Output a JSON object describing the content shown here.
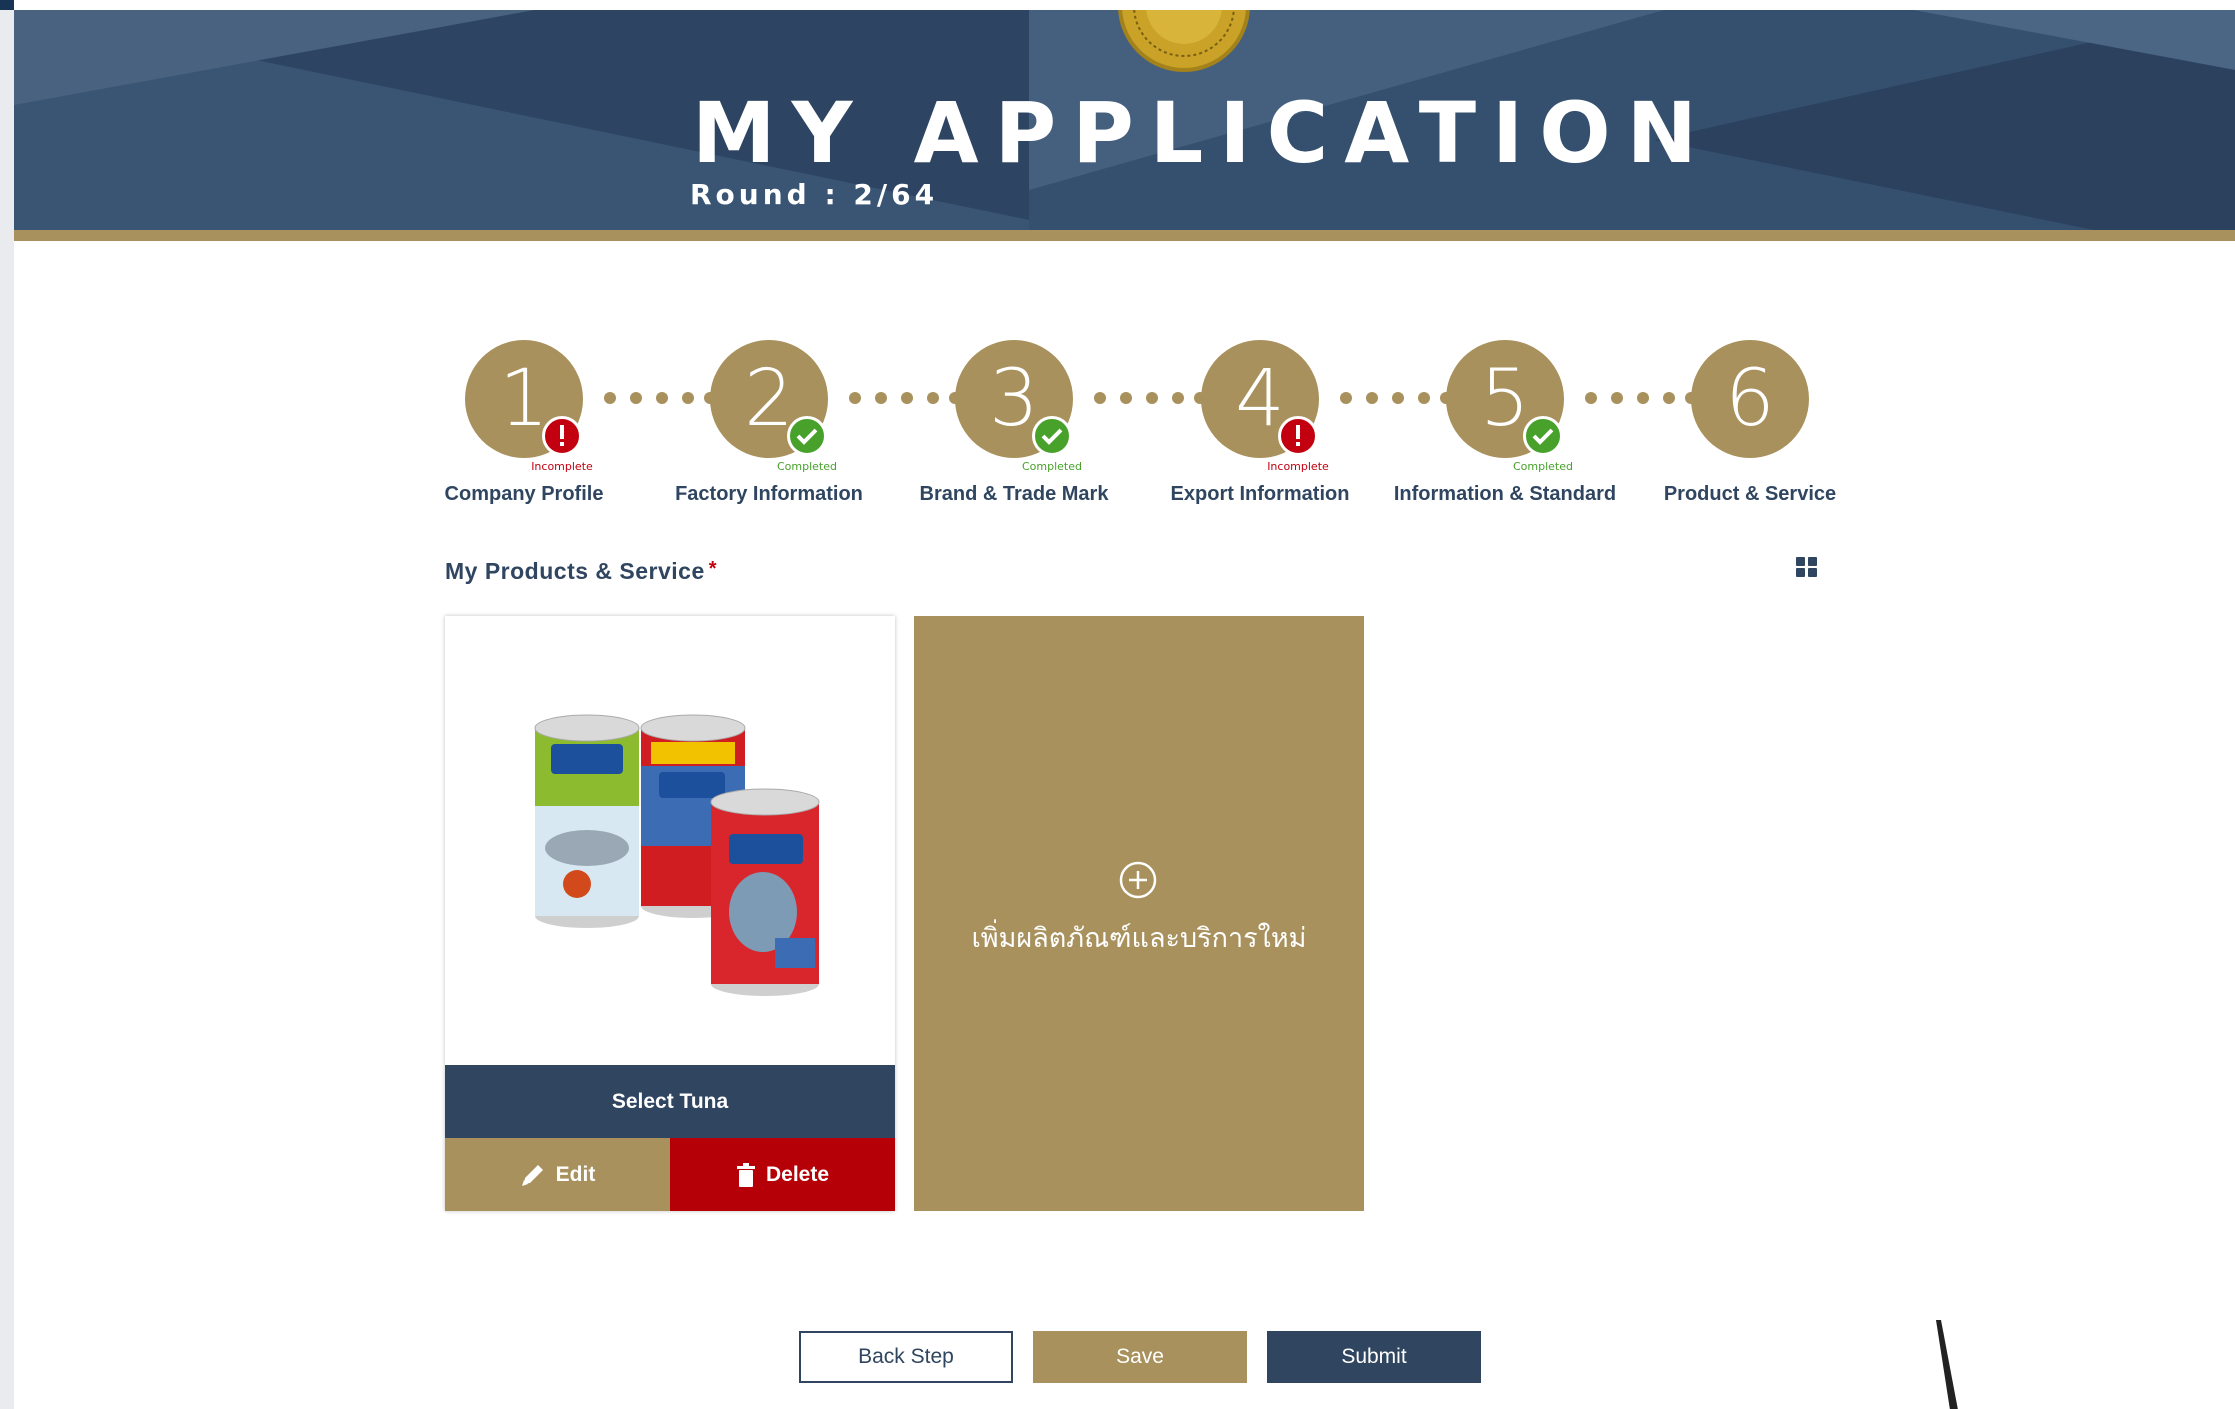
{
  "header": {
    "title": "MY APPLICATION",
    "round": "Round : 2/64"
  },
  "stepper": {
    "steps": [
      {
        "number": "1",
        "label": "Company Profile",
        "status": "Incomplete"
      },
      {
        "number": "2",
        "label": "Factory Information",
        "status": "Completed"
      },
      {
        "number": "3",
        "label": "Brand & Trade Mark",
        "status": "Completed"
      },
      {
        "number": "4",
        "label": "Export Information",
        "status": "Incomplete"
      },
      {
        "number": "5",
        "label": "Information & Standard",
        "status": "Completed"
      },
      {
        "number": "6",
        "label": "Product & Service",
        "status": ""
      }
    ]
  },
  "section": {
    "title": "My Products & Service",
    "required_marker": "*",
    "view_toggle_icon": "grid-view-icon"
  },
  "products": [
    {
      "name": "Select Tuna",
      "edit_label": "Edit",
      "delete_label": "Delete"
    }
  ],
  "add_card": {
    "label": "เพิ่มผลิตภัณฑ์และบริการใหม่",
    "icon": "plus-circle-icon"
  },
  "footer": {
    "back_label": "Back Step",
    "save_label": "Save",
    "submit_label": "Submit"
  },
  "colors": {
    "navy": "#2f4560",
    "gold": "#a8915c",
    "incomplete": "#c3000f",
    "completed": "#48a12b",
    "delete": "#b50007"
  }
}
